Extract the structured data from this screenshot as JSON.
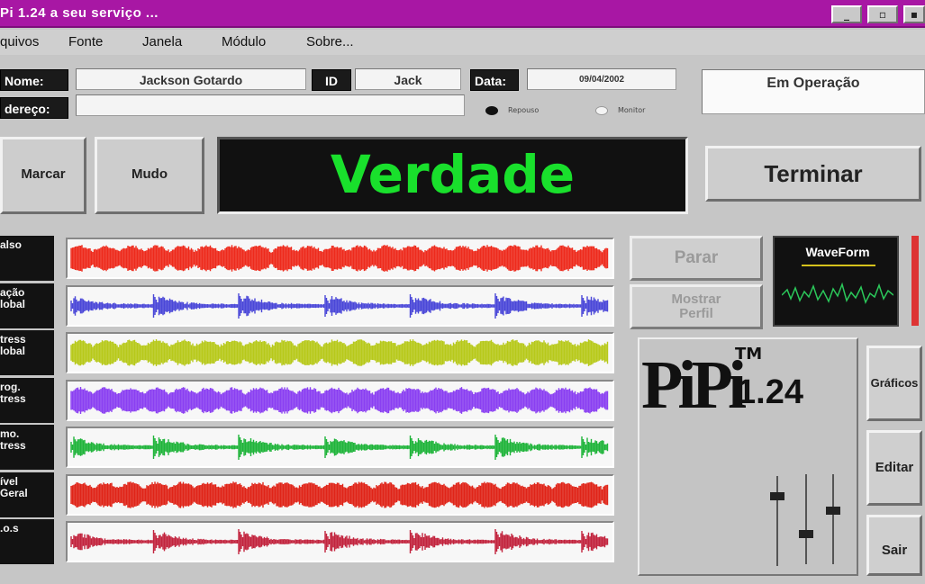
{
  "window": {
    "title": "Pi 1.24 a seu serviço ...",
    "buttons": [
      "_",
      "▫",
      "▪"
    ]
  },
  "menu": [
    "quivos",
    "Fonte",
    "Janela",
    "Módulo",
    "Sobre..."
  ],
  "info": {
    "nome_label": "Nome:",
    "nome_value": "Jackson Gotardo",
    "id_label": "ID",
    "id_value": "Jack",
    "data_label": "Data:",
    "data_value": "09/04/2002",
    "endereco_label": "dereço:",
    "endereco_value": "",
    "radio_1": "Repouso",
    "radio_2": "Monitor",
    "status": "Em Operação"
  },
  "controls": {
    "marcar": "Marcar",
    "mudo": "Mudo",
    "result": "Verdade",
    "terminar": "Terminar",
    "parar": "Parar",
    "mostrar_perfil": "Mostrar Perfil",
    "waveform_title": "WaveForm",
    "graficos": "Gráficos",
    "editar": "Editar",
    "sair": "Sair"
  },
  "channels": [
    {
      "label": "also",
      "color": "#ee2a1c",
      "style": "dense"
    },
    {
      "label": "ação\nlobal",
      "color": "#4a47d8",
      "style": "spiky"
    },
    {
      "label": "tress\nlobal",
      "color": "#b7c91a",
      "style": "dense"
    },
    {
      "label": "rog.\ntress",
      "color": "#8a3ff2",
      "style": "dense"
    },
    {
      "label": "mo.\ntress",
      "color": "#1fb43a",
      "style": "spiky"
    },
    {
      "label": "ível\nGeral",
      "color": "#e02418",
      "style": "dense"
    },
    {
      "label": ".o.s",
      "color": "#c2243e",
      "style": "spiky"
    }
  ],
  "logo": {
    "name": "PiPi",
    "tm": "TM",
    "version": "1.24"
  },
  "colors": {
    "titlebar": "#a817a4",
    "result_text": "#19e02c",
    "waveform_line": "#2bc85a",
    "waveform_underline": "#d6c21c"
  }
}
